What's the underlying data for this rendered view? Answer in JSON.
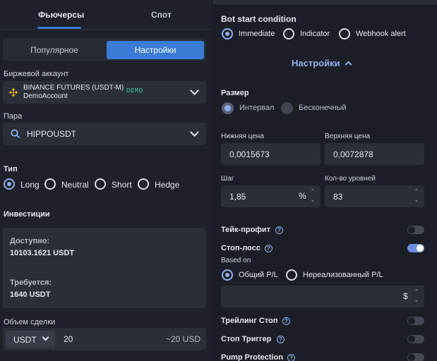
{
  "tabs": {
    "futures": "Фьючерсы",
    "spot": "Спот"
  },
  "segment": {
    "popular": "Популярное",
    "settings": "Настройки"
  },
  "exchange": {
    "label": "Биржевой аккаунт",
    "name": "BINANCE FUTURES (USDT-M)",
    "account": "DemoAccount",
    "badge": "DEMO"
  },
  "pair": {
    "label": "Пара",
    "value": "HIPPOUSDT"
  },
  "type": {
    "label": "Тип",
    "options": [
      "Long",
      "Neutral",
      "Short",
      "Hedge"
    ],
    "selected": "Long"
  },
  "investments": {
    "label": "Инвестиции",
    "available_label": "Доступно:",
    "available_value": "10103.1621 USDT",
    "required_label": "Требуется:",
    "required_value": "1640 USDT"
  },
  "deal_volume": {
    "label": "Объем сделки",
    "currency": "USDT",
    "value": "20",
    "approx": "~20 USD"
  },
  "bot_start": {
    "label": "Bot start condition",
    "options": [
      "Immediate",
      "Indicator",
      "Webhook alert"
    ],
    "selected": "Immediate"
  },
  "settings_toggle": "Настройки",
  "size": {
    "label": "Размер",
    "options": [
      "Интервал",
      "Бесконечный"
    ],
    "selected": "Интервал"
  },
  "lower_price": {
    "label": "Нижняя цена",
    "value": "0,0015673"
  },
  "upper_price": {
    "label": "Верхняя цена",
    "value": "0,0072878"
  },
  "step": {
    "label": "Шаг",
    "value": "1,85",
    "unit": "%"
  },
  "levels": {
    "label": "Кол-во уровней",
    "value": "83"
  },
  "take_profit": {
    "label": "Тейк-профит",
    "enabled": false
  },
  "stop_loss": {
    "label": "Стоп-лосс",
    "enabled": true,
    "based_on_label": "Based on",
    "options": [
      "Общий P/L",
      "Нереализованный P/L"
    ],
    "selected": "Общий P/L",
    "currency": "$"
  },
  "trailing_stop": {
    "label": "Трейлинг Стоп",
    "enabled": false
  },
  "stop_trigger": {
    "label": "Стоп Триггер",
    "enabled": false
  },
  "pump_protection": {
    "label": "Pump Protection",
    "enabled": false
  },
  "colors": {
    "accent": "#3a7bd5",
    "demo_badge": "#2ecfa0",
    "binance": "#f0b90b"
  }
}
